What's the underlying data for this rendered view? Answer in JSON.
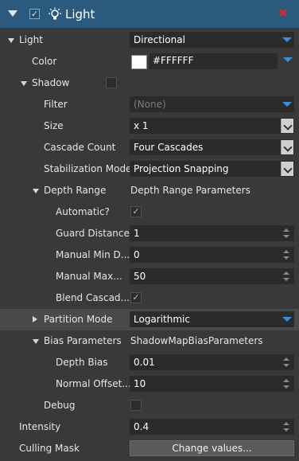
{
  "header": {
    "title": "Light",
    "enabled_mark": "✓",
    "close_mark": "✖"
  },
  "light": {
    "label": "Light",
    "value": "Directional"
  },
  "color": {
    "label": "Color",
    "value": "#FFFFFF",
    "swatch_hex": "#FFFFFF"
  },
  "shadow": {
    "label": "Shadow",
    "filter": {
      "label": "Filter",
      "value": "(None)"
    },
    "size": {
      "label": "Size",
      "value": "x 1"
    },
    "cascade_count": {
      "label": "Cascade Count",
      "value": "Four Cascades"
    },
    "stabilization_mode": {
      "label": "Stabilization Mode",
      "value": "Projection Snapping"
    },
    "depth_range": {
      "label": "Depth Range",
      "value": "Depth Range Parameters",
      "automatic": {
        "label": "Automatic?",
        "mark": "✓"
      },
      "guard_distance": {
        "label": "Guard Distance",
        "value": "1"
      },
      "manual_min": {
        "label": "Manual Min D...",
        "value": "0"
      },
      "manual_max": {
        "label": "Manual Max...",
        "value": "50"
      },
      "blend_cascades": {
        "label": "Blend Cascad...",
        "mark": "✓"
      }
    },
    "partition_mode": {
      "label": "Partition Mode",
      "value": "Logarithmic"
    },
    "bias_parameters": {
      "label": "Bias Parameters",
      "value": "ShadowMapBiasParameters",
      "depth_bias": {
        "label": "Depth Bias",
        "value": "0.01"
      },
      "normal_offset": {
        "label": "Normal Offset...",
        "value": "10"
      }
    },
    "debug": {
      "label": "Debug"
    }
  },
  "intensity": {
    "label": "Intensity",
    "value": "0.4"
  },
  "culling_mask": {
    "label": "Culling Mask",
    "button": "Change values..."
  },
  "colors": {
    "header_bg": "#2A5A7E",
    "panel_bg": "#393939",
    "field_bg": "#2B2B2B",
    "accent_blue": "#3A8FD8",
    "close_red": "#D92A2A"
  }
}
